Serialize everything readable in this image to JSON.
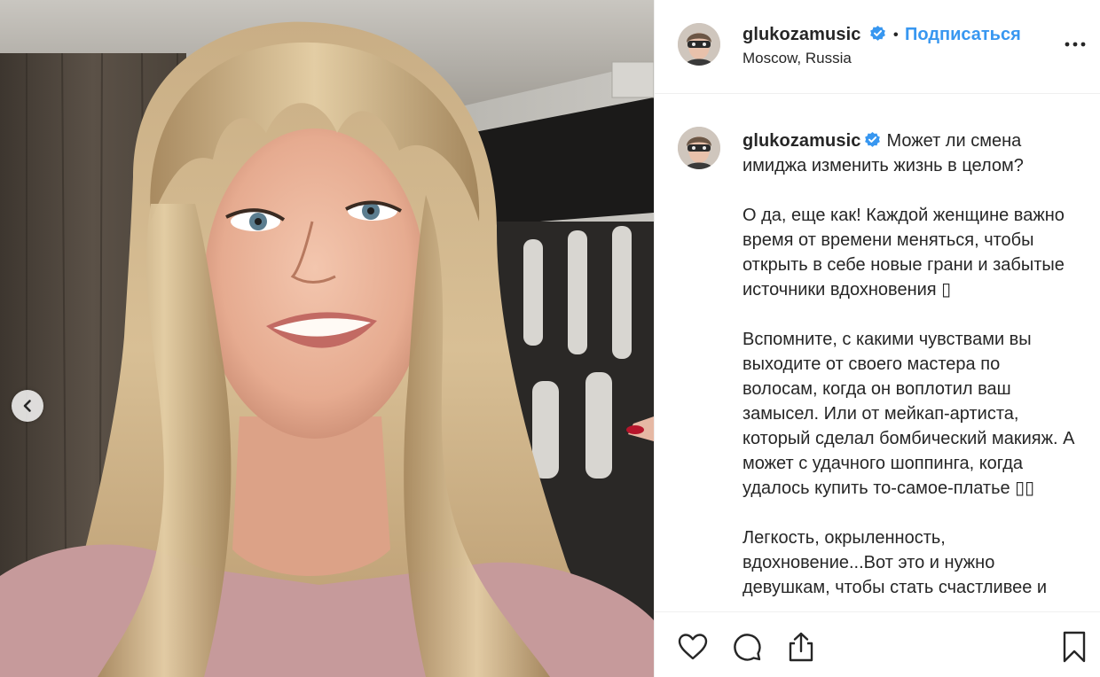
{
  "post": {
    "user": {
      "username": "glukozamusic",
      "location": "Moscow, Russia",
      "follow_label": "Подписаться",
      "separator": "•",
      "verified_icon": "verified-badge-icon"
    },
    "caption": {
      "username": "glukozamusic",
      "text": "Может ли смена имиджа изменить жизнь в целом?\n\nО да, еще как! Каждой женщине важно время от времени меняться, чтобы открыть в себе новые грани и забытые источники вдохновения ▯\n\nВспомните, с какими чувствами вы выходите от своего мастера по волосам, когда он воплотил ваш замысел. Или от мейкап-артиста, который сделал бомбический макияж. А может с удачного шоппинга, когда удалось купить то-самое-платье ▯▯\n\nЛегкость, окрыленность, вдохновение...Вот это и нужно девушкам, чтобы стать счастливее и"
    },
    "icons": {
      "more": "more-options-icon",
      "prev": "chevron-left-icon",
      "like": "heart-icon",
      "comment": "comment-icon",
      "share": "share-icon",
      "save": "bookmark-icon"
    },
    "colors": {
      "accent": "#3897f0",
      "text": "#262626",
      "divider": "#efefef"
    }
  }
}
